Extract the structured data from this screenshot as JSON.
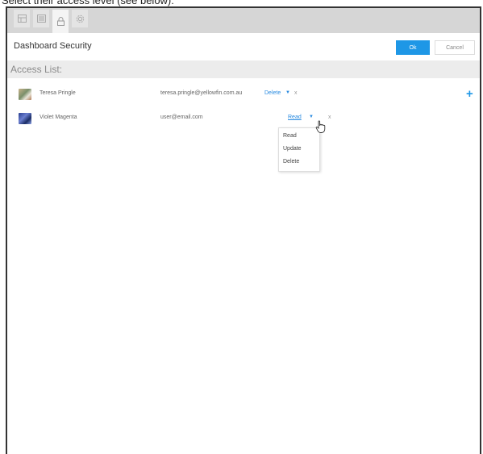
{
  "caption": "Select their access level (see below):",
  "tabs": [
    {
      "icon": "grid-icon"
    },
    {
      "icon": "list-icon"
    },
    {
      "icon": "lock-icon",
      "active": true
    },
    {
      "icon": "gear-icon"
    }
  ],
  "header": {
    "title": "Dashboard Security",
    "ok_label": "Ok",
    "cancel_label": "Cancel"
  },
  "access_list": {
    "heading": "Access List:",
    "rows": [
      {
        "name": "Teresa Pringle",
        "email": "teresa.pringle@yellowfin.com.au",
        "level": "Delete",
        "avatar": "teresa-avatar"
      },
      {
        "name": "Violet Magenta",
        "email": "user@email.com",
        "level": "Read",
        "avatar": "violet-avatar"
      }
    ],
    "remove_label": "x",
    "add_label": "+"
  },
  "dropdown": {
    "options": [
      "Read",
      "Update",
      "Delete"
    ]
  },
  "colors": {
    "accent": "#1e97e6",
    "tabbar": "#d6d6d6",
    "section": "#ececec"
  }
}
